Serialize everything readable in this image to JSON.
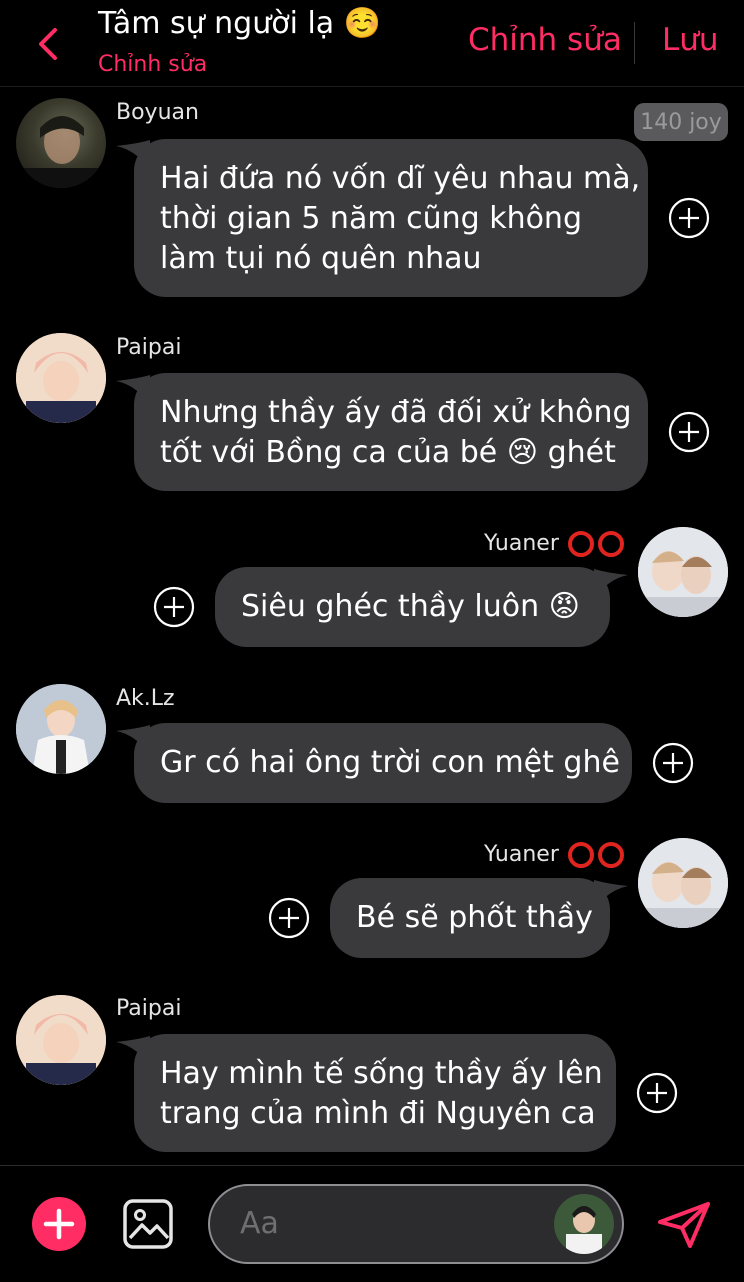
{
  "header": {
    "title": "Tâm sự người lạ ☺️",
    "subtitle": "Chỉnh sửa",
    "edit_label": "Chỉnh sửa",
    "save_label": "Lưu"
  },
  "messages": [
    {
      "sender": "Boyuan",
      "lines": [
        "Hai đứa nó vốn dĩ yêu nhau mà,",
        "thời gian 5 năm cũng không",
        "làm tụi nó quên nhau"
      ],
      "side": "left"
    },
    {
      "sender": "Paipai",
      "lines": [
        "Nhưng thầy ấy đã đối xử không",
        "tốt với Bồng ca của bé 😢 ghét"
      ],
      "side": "left"
    },
    {
      "sender": "Yuaner",
      "lines": [
        "Siêu ghéc thầy luôn 😡"
      ],
      "side": "right"
    },
    {
      "sender": "Ak.Lz",
      "lines": [
        "Gr có hai ông trời con mệt ghê"
      ],
      "side": "left"
    },
    {
      "sender": "Yuaner",
      "lines": [
        "Bé sẽ phốt thầy"
      ],
      "side": "right"
    },
    {
      "sender": "Paipai",
      "lines": [
        "Hay mình tế sống thầy ấy lên",
        "trang của mình đi Nguyên ca"
      ],
      "side": "left"
    }
  ],
  "joy_badge": "140 joy",
  "composer": {
    "placeholder": "Aa"
  },
  "colors": {
    "accent": "#ff2d64",
    "bubble": "#3a3a3c",
    "background": "#000000"
  }
}
